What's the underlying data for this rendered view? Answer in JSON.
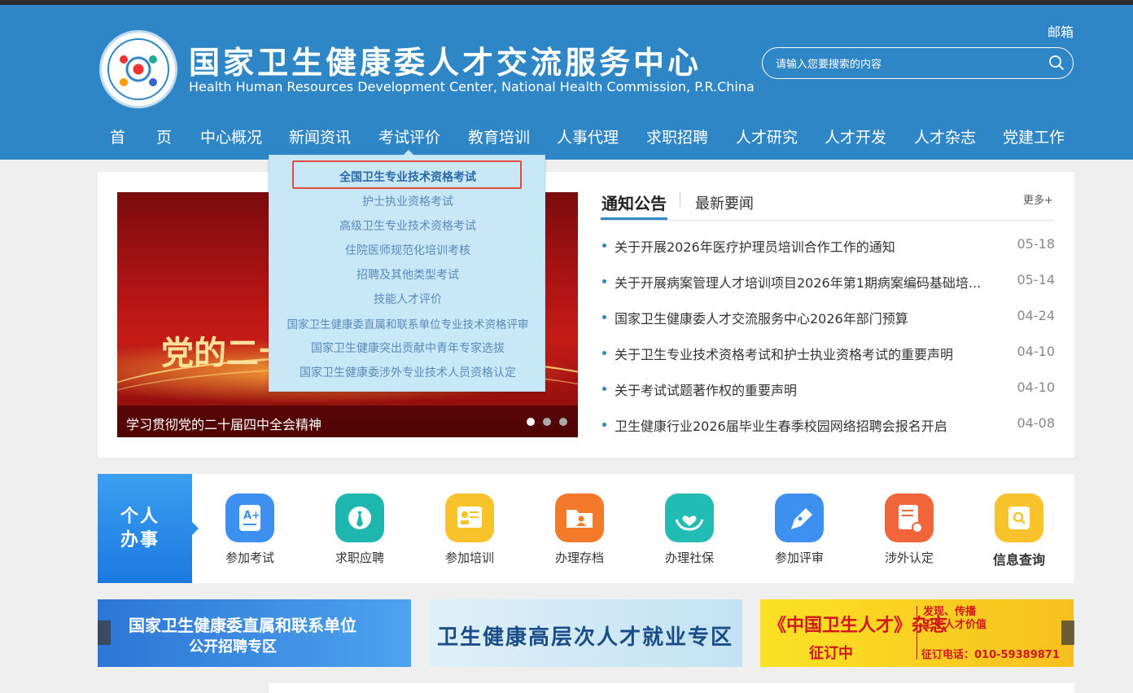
{
  "header": {
    "title": "国家卫生健康委人才交流服务中心",
    "subtitle": "Health Human Resources Development Center, National Health Commission, P.R.China",
    "mail_label": "邮箱",
    "search_placeholder": "请输入您要搜索的内容"
  },
  "nav": [
    "首　　页",
    "中心概况",
    "新闻资讯",
    "考试评价",
    "教育培训",
    "人事代理",
    "求职招聘",
    "人才研究",
    "人才开发",
    "人才杂志",
    "党建工作"
  ],
  "dropdown": [
    "全国卫生专业技术资格考试",
    "护士执业资格考试",
    "高级卫生专业技术资格考试",
    "住院医师规范化培训考核",
    "招聘及其他类型考试",
    "技能人才评价",
    "国家卫生健康委直属和联系单位专业技术资格评审",
    "国家卫生健康突出贡献中青年专家选拔",
    "国家卫生健康委涉外专业技术人员资格认定"
  ],
  "banner": {
    "headline": "党的二十",
    "caption": "学习贯彻党的二十届四中全会精神"
  },
  "news_tabs": {
    "active": "通知公告",
    "other": "最新要闻",
    "more": "更多+"
  },
  "news": [
    {
      "title": "关于开展2026年医疗护理员培训合作工作的通知",
      "date": "05-18"
    },
    {
      "title": "关于开展病案管理人才培训项目2026年第1期病案编码基础培...",
      "date": "05-14"
    },
    {
      "title": "国家卫生健康委人才交流服务中心2026年部门预算",
      "date": "04-24"
    },
    {
      "title": "关于卫生专业技术资格考试和护士执业资格考试的重要声明",
      "date": "04-10"
    },
    {
      "title": "关于考试试题著作权的重要声明",
      "date": "04-10"
    },
    {
      "title": "卫生健康行业2026届毕业生春季校园网络招聘会报名开启",
      "date": "04-08"
    }
  ],
  "personal": {
    "label": "个人办事"
  },
  "services": [
    {
      "label": "参加考试",
      "icon": "exam-icon",
      "color": "#3d8ff0"
    },
    {
      "label": "求职应聘",
      "icon": "tie-icon",
      "color": "#1db7b0"
    },
    {
      "label": "参加培训",
      "icon": "training-icon",
      "color": "#f7c22a"
    },
    {
      "label": "办理存档",
      "icon": "folder-icon",
      "color": "#f47a2a"
    },
    {
      "label": "办理社保",
      "icon": "heart-hands-icon",
      "color": "#22bcb4"
    },
    {
      "label": "参加评审",
      "icon": "pen-icon",
      "color": "#3d8ff0"
    },
    {
      "label": "涉外认定",
      "icon": "certificate-icon",
      "color": "#f0663a"
    },
    {
      "label": "信息查询",
      "icon": "query-icon",
      "color": "#f7c22a"
    }
  ],
  "ads": {
    "ad1_line1": "国家卫生健康委直属和联系单位",
    "ad1_line2": "公开招聘专区",
    "ad2": "卫生健康高层次人才就业专区",
    "ad3_title": "《中国卫生人才》杂志",
    "ad3_sub": "征订中",
    "ad3_slogan1": "发现、传播",
    "ad3_slogan2": "卫生人才价值",
    "ad3_phone": "征订电话：010-59389871"
  }
}
